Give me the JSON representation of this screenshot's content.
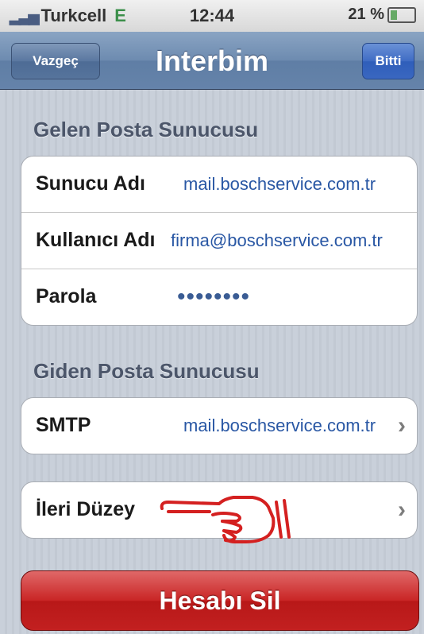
{
  "status_bar": {
    "carrier": "Turkcell",
    "network": "E",
    "time": "12:44",
    "battery": "21 %"
  },
  "nav": {
    "cancel_label": "Vazgeç",
    "title": "Interbim",
    "done_label": "Bitti"
  },
  "incoming": {
    "section_title": "Gelen Posta Sunucusu",
    "rows": [
      {
        "label": "Sunucu Adı",
        "value": "mail.boschservice.com.tr"
      },
      {
        "label": "Kullanıcı Adı",
        "value": "firma@boschservice.com.tr"
      },
      {
        "label": "Parola",
        "value": "••••••••"
      }
    ]
  },
  "outgoing": {
    "section_title": "Giden Posta Sunucusu",
    "smtp_label": "SMTP",
    "smtp_value": "mail.boschservice.com.tr"
  },
  "advanced": {
    "label": "İleri Düzey"
  },
  "delete_label": "Hesabı Sil",
  "colors": {
    "nav_blue": "#6d8bb0",
    "link_blue": "#2957a4",
    "delete_red": "#c92525",
    "hand_red": "#d42020"
  },
  "icons": {
    "pointer": "pointing-hand-icon",
    "chevron": "chevron-right-icon"
  }
}
